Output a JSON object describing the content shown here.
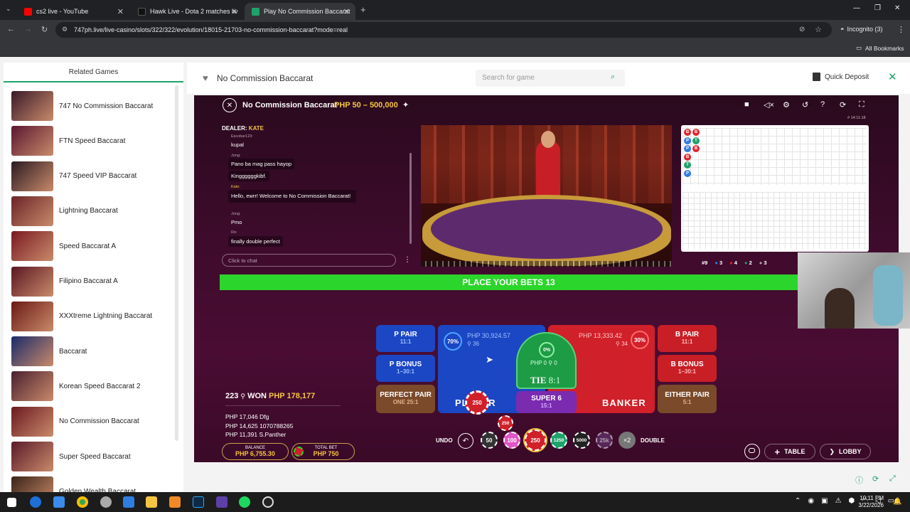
{
  "tabs": [
    {
      "title": "cs2 live - YouTube",
      "color": "#ff0000"
    },
    {
      "title": "Hawk Live - Dota 2 matches liv",
      "color": "#111111"
    },
    {
      "title": "Play No Commission Baccarat",
      "color": "#1ea36b"
    }
  ],
  "url": "747ph.live/live-casino/slots/322/322/evolution/18015-21703-no-commission-baccarat?mode=real",
  "incognito": "Incognito (3)",
  "all_bookmarks": "All Bookmarks",
  "sidebar": {
    "title": "Related Games",
    "games": [
      "747 No Commission Baccarat",
      "FTN Speed Baccarat",
      "747 Speed VIP Baccarat",
      "Lightning Baccarat",
      "Speed Baccarat A",
      "Filipino Baccarat A",
      "XXXtreme Lightning Baccarat",
      "Baccarat",
      "Korean Speed Baccarat 2",
      "No Commission Baccarat",
      "Super Speed Baccarat",
      "Golden Wealth Baccarat"
    ]
  },
  "header": {
    "game_title": "No Commission Baccarat",
    "search_placeholder": "Search for game",
    "quick_deposit": "Quick Deposit"
  },
  "player": {
    "title": "No Commission Baccarat",
    "limits": "PHP 50 – 500,000",
    "time": "# 14:11:18",
    "dealer_label": "DEALER:",
    "dealer_name": "KATE",
    "chat_placeholder": "Click to chat",
    "chat": [
      {
        "name": "Escobar123:",
        "text": "kupal"
      },
      {
        "name": "Jong:",
        "text": "Pano ba mag pass hayop"
      },
      {
        "name": "",
        "text": "Kinggggggkibf."
      },
      {
        "name": "Kate:",
        "text": "Hello, ewrr! Welcome to No Commission Baccarat!"
      },
      {
        "name": "Jong:",
        "text": "Pmo"
      },
      {
        "name": "Ro:",
        "text": "finally double perfect"
      }
    ],
    "banner": "PLACE YOUR BETS 13",
    "stats": {
      "total": "9",
      "p": "3",
      "b": "4",
      "t": "2",
      "pp": "3"
    },
    "bets": {
      "p_pair": "P PAIR",
      "p_pair_odds": "11:1",
      "p_bonus": "P BONUS",
      "p_bonus_odds": "1–30:1",
      "perfect_pair": "PERFECT PAIR",
      "perfect_pair_odds": "ONE 25:1",
      "player_amount": "PHP 30,924.57",
      "player_count": "36",
      "player_pct": "70%",
      "player_label": "PLAYER",
      "tie_amount": "PHP 0",
      "tie_count": "0",
      "tie_pct": "0%",
      "tie_label": "TIE",
      "tie_odds": "8:1",
      "super6": "SUPER 6",
      "super6_odds": "15:1",
      "banker_amount": "PHP 13,333.42",
      "banker_count": "34",
      "banker_pct": "30%",
      "banker_label": "BANKER",
      "b_pair": "B PAIR",
      "b_pair_odds": "11:1",
      "b_bonus": "B BONUS",
      "b_bonus_odds": "1–30:1",
      "either_pair": "EITHER PAIR",
      "either_pair_odds": "5:1"
    },
    "winners_count": "223",
    "won_label": "WON",
    "won_amount": "PHP 178,177",
    "winners": [
      {
        "amount": "PHP 17,046",
        "name": "Dfg"
      },
      {
        "amount": "PHP 14,625",
        "name": "1070788265"
      },
      {
        "amount": "PHP 11,391",
        "name": "S.Panther"
      }
    ],
    "balance_label": "BALANCE",
    "balance": "PHP 6,755.30",
    "total_bet_label": "TOTAL BET",
    "total_bet": "PHP 750",
    "undo": "UNDO",
    "double": "DOUBLE",
    "chips": [
      "50",
      "100",
      "250",
      "1250",
      "5000",
      "25k"
    ],
    "x2": "×2",
    "placed_chip": "250",
    "table_btn": "TABLE",
    "lobby_btn": "LOBBY"
  },
  "clock": {
    "time": "10:11 PM",
    "date": "3/22/2026"
  }
}
